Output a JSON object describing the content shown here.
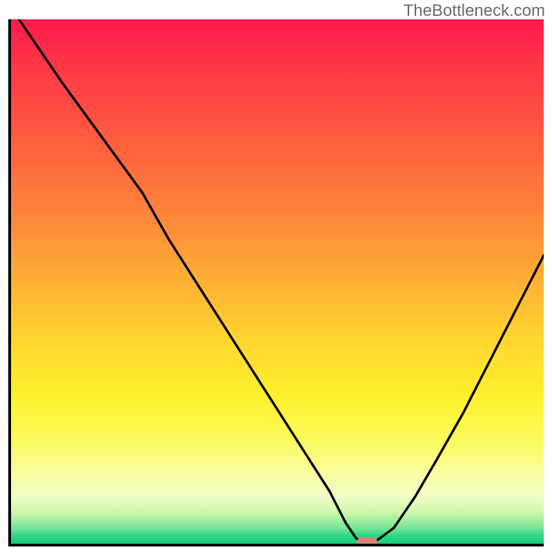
{
  "watermark": "TheBottleneck.com",
  "colors": {
    "gradient_top": "#ff1a4a",
    "gradient_mid": "#ffd82f",
    "gradient_bottom": "#18cf7d",
    "curve": "#000000",
    "marker": "#e27e7a",
    "axis": "#000000"
  },
  "chart_data": {
    "type": "line",
    "title": "",
    "xlabel": "",
    "ylabel": "",
    "xlim": [
      0,
      100
    ],
    "ylim": [
      0,
      100
    ],
    "x": [
      2,
      10,
      20,
      25,
      30,
      35,
      40,
      45,
      50,
      55,
      60,
      63,
      65,
      67,
      68,
      72,
      76,
      80,
      85,
      90,
      95,
      100
    ],
    "values": [
      100,
      88,
      74,
      67,
      58,
      50,
      42,
      34,
      26,
      18,
      10,
      4,
      1,
      0,
      0,
      3,
      9,
      16,
      25,
      35,
      45,
      55
    ],
    "marker": {
      "x": 67,
      "y": 0
    },
    "background": "vertical rainbow gradient red→yellow→green indicating bottleneck severity (top=high, bottom=low)"
  }
}
